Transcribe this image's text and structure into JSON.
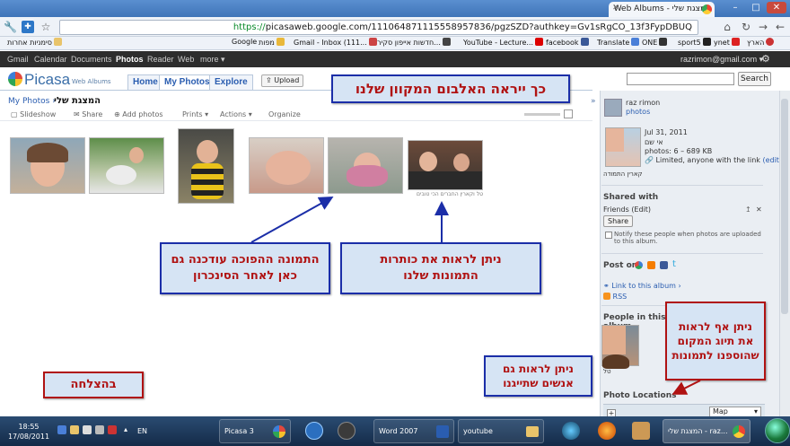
{
  "browser": {
    "tab_title": "המצגת שלי - Web Albums",
    "url_scheme": "https://",
    "url_rest": "picasaweb.google.com/111064871115558957836/pgzSZD?authkey=Gv1sRgCO_13f3FypDBUQ",
    "window_buttons": [
      "–",
      "□",
      "✕"
    ],
    "bookmarks": [
      "הארץ",
      "ynet",
      "sport5",
      "ONE",
      "Translate",
      "facebook",
      "YouTube - Lecture...",
      "חדשות אייפון סקיר...",
      "Gmail - Inbox (111...",
      "מפות",
      "Google",
      "סימניות אחרות"
    ]
  },
  "gbar": {
    "links": [
      "Gmail",
      "Calendar",
      "Documents",
      "Photos",
      "Reader",
      "Web",
      "more ▾"
    ],
    "active": "Photos",
    "account": "razrimon@gmail.com ▾"
  },
  "header": {
    "logo": "Picasa",
    "logo_sub": "Web Albums",
    "tabs": [
      "Home",
      "My Photos",
      "Explore"
    ],
    "upload": "Upload",
    "search_button": "Search"
  },
  "album": {
    "crumb_link": "My Photos",
    "crumb_sep": "›",
    "title": "המצגת שלי",
    "actions": [
      "Slideshow",
      "Share",
      "Add photos",
      "Prints ▾",
      "Actions ▾",
      "Organize"
    ],
    "photo_caption": "טל וקארין החברים הכי טובים"
  },
  "sidebar": {
    "owner_name": "raz rimon",
    "owner_link": "photos",
    "date": "Jul 31, 2011",
    "place": "אי שם",
    "photos_count": "photos: 6 – 689 KB",
    "visibility": "Limited, anyone with the link",
    "edit": "(edit)",
    "cover_caption": "קארין התמודה",
    "shared_with": "Shared with",
    "friends": "Friends (Edit)",
    "share_btn": "Share",
    "notify": "Notify these people when photos are uploaded to this album.",
    "post_on": "Post on:",
    "link_album": "Link to this album ›",
    "rss": "RSS",
    "people": "People in this album",
    "person_name": "טל",
    "locations": "Photo Locations",
    "map_select": "Map"
  },
  "notes": {
    "top": "כך ייראה האלבום המקוון שלנו",
    "rotated": "התמונה ההפוכה עודכנה גם כאן לאחר הסינכרון",
    "captions": "ניתן לראות את כותרות התמונות שלנו",
    "tagging": "ניתן אף לראות את תיוג המקום שהוספנו לתמונות",
    "people": "ניתן לראות גם אנשים שתייגנו",
    "success": "בהצלחה"
  },
  "taskbar": {
    "time": "18:55",
    "date": "17/08/2011",
    "lang": "EN",
    "tasks": [
      "Picasa 3",
      "Word 2007",
      "youtube",
      "המצגת שלי - raz..."
    ]
  }
}
